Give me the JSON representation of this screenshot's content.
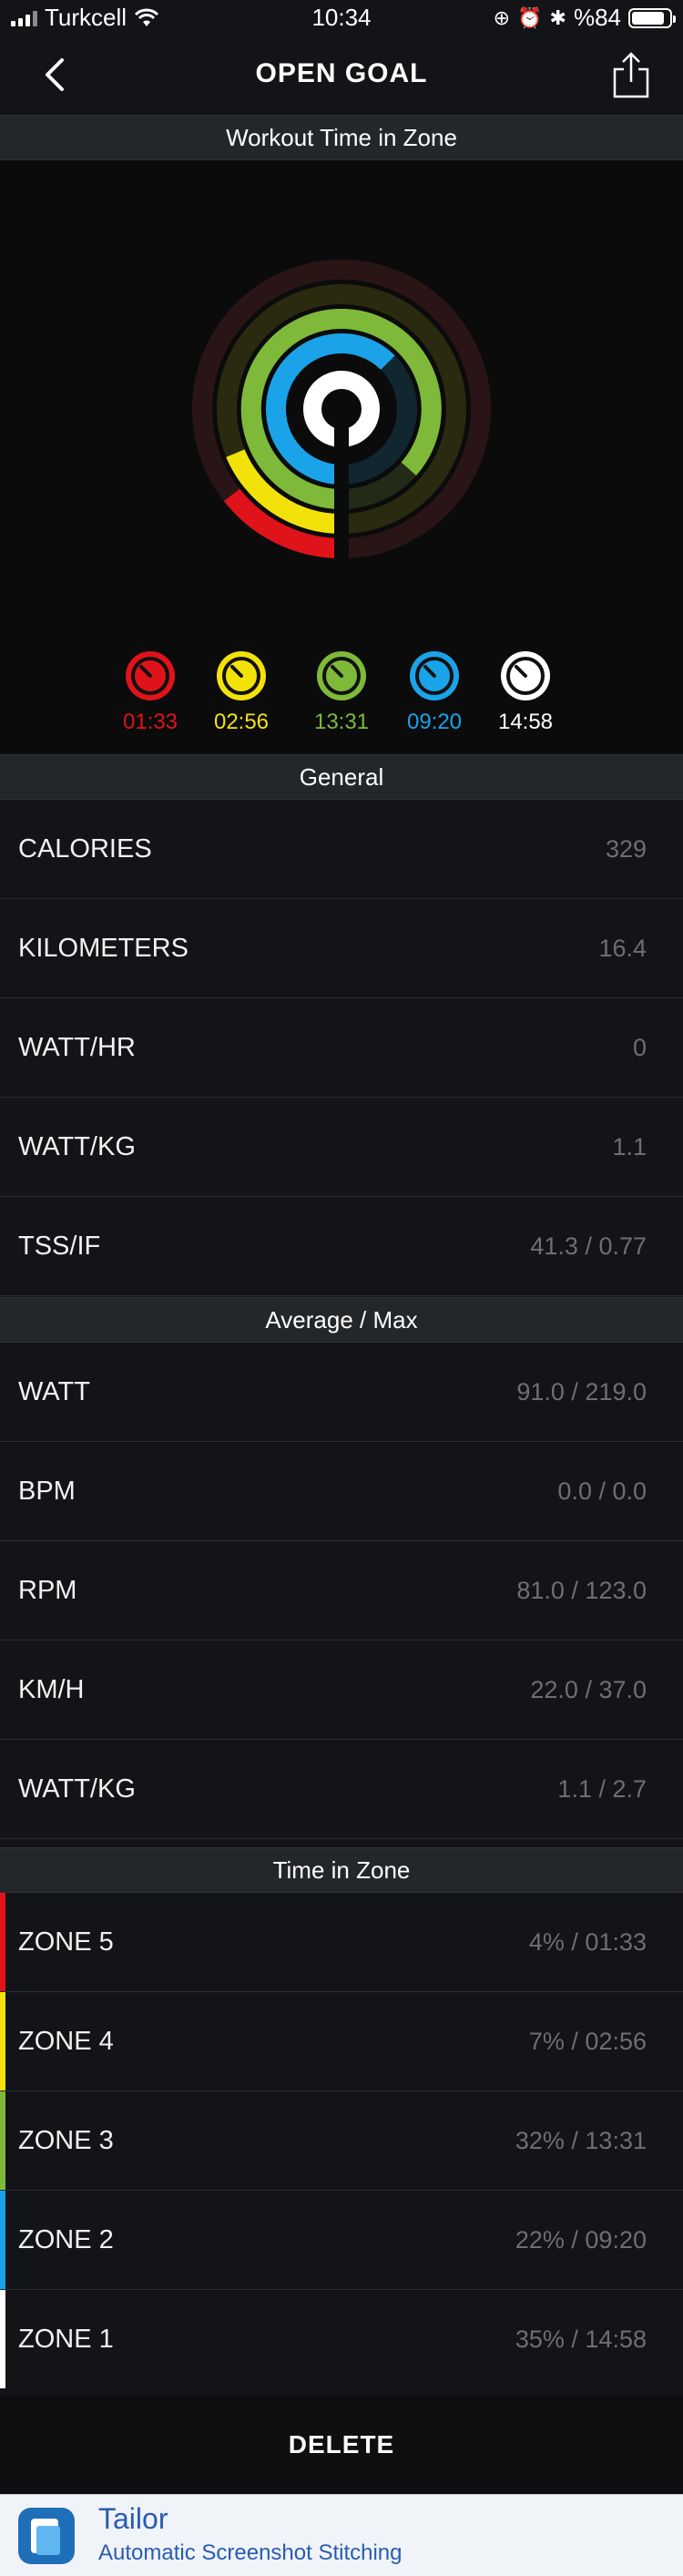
{
  "status": {
    "carrier": "Turkcell",
    "time": "10:34",
    "battery": "%84"
  },
  "navbar": {
    "title": "OPEN GOAL"
  },
  "workout_section": {
    "title": "Workout Time in Zone"
  },
  "legend": [
    {
      "zone": "5",
      "time": "01:33",
      "color": "#e0131b"
    },
    {
      "zone": "4",
      "time": "02:56",
      "color": "#f2e20a"
    },
    {
      "zone": "3",
      "time": "13:31",
      "color": "#7fb93a"
    },
    {
      "zone": "2",
      "time": "09:20",
      "color": "#1aa3e8"
    },
    {
      "zone": "1",
      "time": "14:58",
      "color": "#ffffff"
    }
  ],
  "general": {
    "title": "General",
    "rows": [
      {
        "label": "CALORIES",
        "value": "329"
      },
      {
        "label": "KILOMETERS",
        "value": "16.4"
      },
      {
        "label": "WATT/HR",
        "value": "0"
      },
      {
        "label": "WATT/KG",
        "value": "1.1"
      },
      {
        "label": "TSS/IF",
        "value": "41.3 / 0.77"
      }
    ]
  },
  "average": {
    "title": "Average / Max",
    "rows": [
      {
        "label": "WATT",
        "value": "91.0 / 219.0"
      },
      {
        "label": "BPM",
        "value": "0.0 / 0.0"
      },
      {
        "label": "RPM",
        "value": "81.0 / 123.0"
      },
      {
        "label": "KM/H",
        "value": "22.0 / 37.0"
      },
      {
        "label": "WATT/KG",
        "value": "1.1 / 2.7"
      }
    ]
  },
  "zones": {
    "title": "Time in Zone",
    "rows": [
      {
        "label": "ZONE 5",
        "value": "4% / 01:33",
        "color": "#e0131b"
      },
      {
        "label": "ZONE 4",
        "value": "7% / 02:56",
        "color": "#f2e20a"
      },
      {
        "label": "ZONE 3",
        "value": "32% / 13:31",
        "color": "#7fb93a"
      },
      {
        "label": "ZONE 2",
        "value": "22% / 09:20",
        "color": "#1aa3e8"
      },
      {
        "label": "ZONE 1",
        "value": "35% / 14:58",
        "color": "#ffffff"
      }
    ]
  },
  "delete_label": "DELETE",
  "banner": {
    "name": "Tailor",
    "subtitle": "Automatic Screenshot Stitching"
  }
}
